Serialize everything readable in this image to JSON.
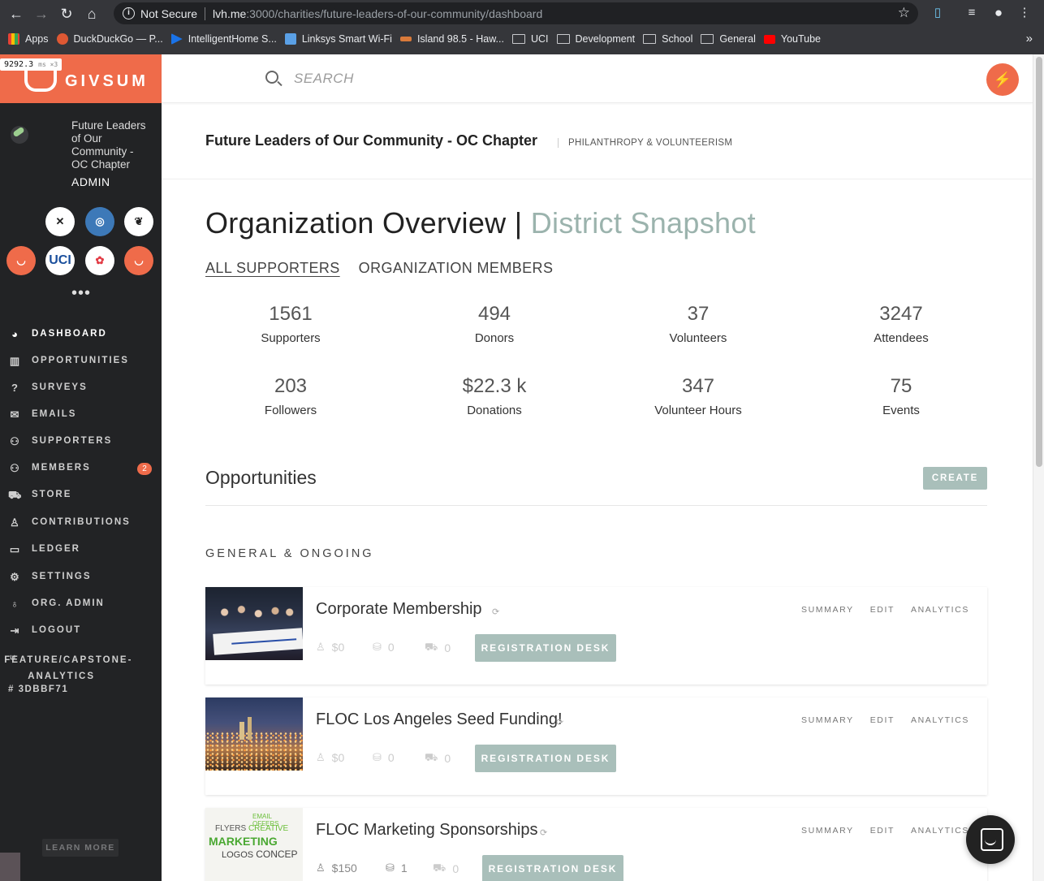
{
  "browser": {
    "security_label": "Not Secure",
    "url_host": "lvh.me",
    "url_rest": ":3000/charities/future-leaders-of-our-community/dashboard",
    "bookmarks": [
      "Apps",
      "DuckDuckGo — P...",
      "IntelligentHome S...",
      "Linksys Smart Wi-Fi",
      "Island 98.5 - Haw...",
      "UCI",
      "Development",
      "School",
      "General",
      "YouTube"
    ]
  },
  "perf_overlay": {
    "value": "9292.3",
    "unit": "ms ×3"
  },
  "brand": {
    "name": "GIVSUM",
    "color": "#ef6b4a"
  },
  "sidebar": {
    "org_name": "Future Leaders of Our Community - OC Chapter",
    "org_role": "ADMIN",
    "orgs": [
      {
        "label": "",
        "bg": "#2b2c2e",
        "fg": "#9ccf8f"
      },
      {
        "label": "✕",
        "bg": "#ffffff",
        "fg": "#222"
      },
      {
        "label": "◎",
        "bg": "#3d79b8",
        "fg": "#fff"
      },
      {
        "label": "❦",
        "bg": "#ffffff",
        "fg": "#222"
      },
      {
        "label": "◡",
        "bg": "#ef6b4a",
        "fg": "#fff"
      },
      {
        "label": "UCI",
        "bg": "#ffffff",
        "fg": "#1a4f9c"
      },
      {
        "label": "✿",
        "bg": "#ffffff",
        "fg": "#e23b45"
      },
      {
        "label": "◡",
        "bg": "#ef6b4a",
        "fg": "#fff"
      }
    ],
    "more": "•••",
    "nav": [
      {
        "label": "DASHBOARD",
        "icon": "gauge-icon"
      },
      {
        "label": "OPPORTUNITIES",
        "icon": "chart-icon"
      },
      {
        "label": "SURVEYS",
        "icon": "question-icon"
      },
      {
        "label": "EMAILS",
        "icon": "envelope-icon"
      },
      {
        "label": "SUPPORTERS",
        "icon": "people-icon"
      },
      {
        "label": "MEMBERS",
        "icon": "people-icon",
        "badge": "2"
      },
      {
        "label": "STORE",
        "icon": "cart-icon"
      },
      {
        "label": "CONTRIBUTIONS",
        "icon": "hand-icon"
      },
      {
        "label": "LEDGER",
        "icon": "card-icon"
      },
      {
        "label": "SETTINGS",
        "icon": "gear-icon"
      },
      {
        "label": "ORG. ADMIN",
        "icon": "pin-icon"
      },
      {
        "label": "LOGOUT",
        "icon": "exit-icon"
      },
      {
        "label": "FEATURE/CAPSTONE-ANALYTICS",
        "icon": "branch-icon"
      }
    ],
    "commit": "# 3DBBF71",
    "learn_more": "LEARN MORE"
  },
  "search": {
    "placeholder": "SEARCH"
  },
  "header": {
    "org_title": "Future Leaders of Our Community - OC Chapter",
    "category": "PHILANTHROPY & VOLUNTEERISM"
  },
  "overview": {
    "title": "Organization Overview",
    "divider": "|",
    "subtitle": "District Snapshot",
    "tabs": [
      "ALL SUPPORTERS",
      "ORGANIZATION MEMBERS"
    ]
  },
  "stats": [
    {
      "value": "1561",
      "label": "Supporters"
    },
    {
      "value": "494",
      "label": "Donors"
    },
    {
      "value": "37",
      "label": "Volunteers"
    },
    {
      "value": "3247",
      "label": "Attendees"
    },
    {
      "value": "203",
      "label": "Followers"
    },
    {
      "value": "$22.3 k",
      "label": "Donations"
    },
    {
      "value": "347",
      "label": "Volunteer Hours"
    },
    {
      "value": "75",
      "label": "Events"
    }
  ],
  "opportunities": {
    "title": "Opportunities",
    "create_label": "CREATE",
    "section": "GENERAL & ONGOING",
    "actions": [
      "SUMMARY",
      "EDIT",
      "ANALYTICS"
    ],
    "reg_desk_label": "REGISTRATION DESK",
    "items": [
      {
        "title": "Corporate Membership",
        "amount": "$0",
        "count": "0",
        "store": "0",
        "active": false
      },
      {
        "title": "FLOC Los Angeles Seed Funding!",
        "amount": "$0",
        "count": "0",
        "store": "0",
        "active": false
      },
      {
        "title": "FLOC Marketing Sponsorships",
        "amount": "$150",
        "count": "1",
        "store": "0",
        "active": true
      }
    ]
  }
}
